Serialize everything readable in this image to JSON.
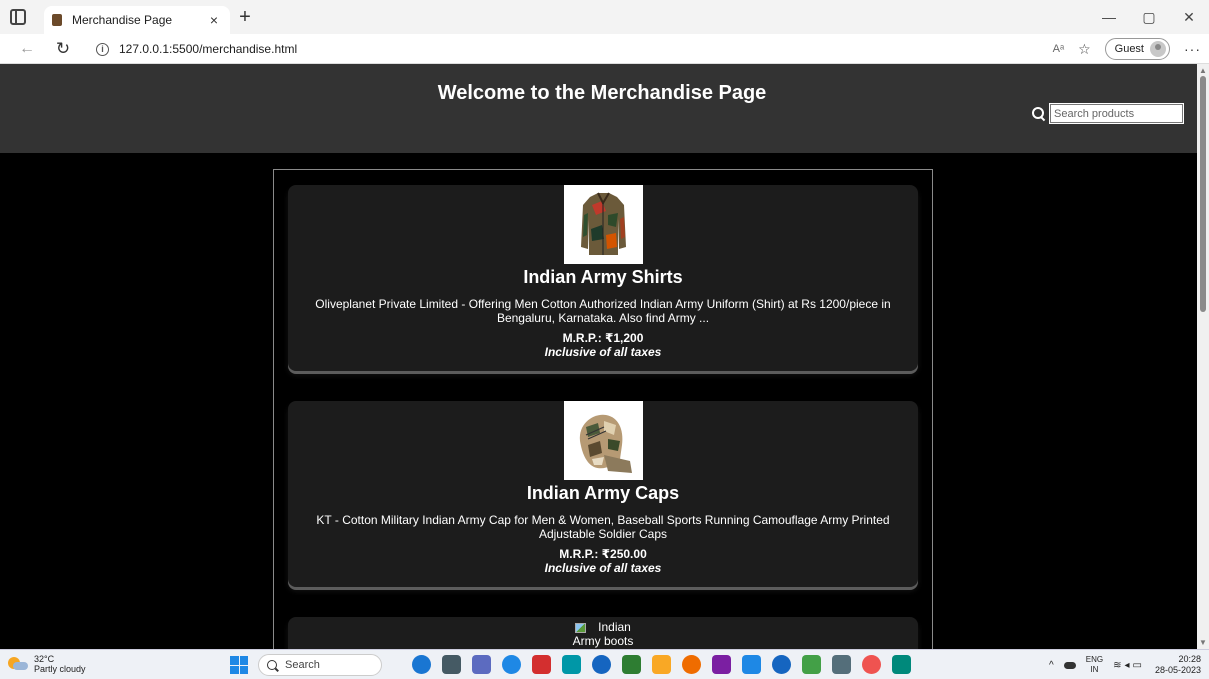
{
  "browser": {
    "tab_title": "Merchandise Page",
    "tab_close": "×",
    "new_tab": "+",
    "url": "127.0.0.1:5500/merchandise.html",
    "read_aloud": "Aᵃ",
    "profile_label": "Guest",
    "more": "···",
    "window_controls": [
      "—",
      "▢",
      "✕"
    ]
  },
  "page": {
    "title": "Welcome to the Merchandise Page",
    "search_placeholder": "Search products"
  },
  "products": [
    {
      "title": "Indian Army Shirts",
      "description": "Oliveplanet Private Limited - Offering Men Cotton Authorized Indian Army Uniform (Shirt) at Rs 1200/piece in Bengaluru, Karnataka. Also find Army ...",
      "price": "M.R.P.: ₹1,200",
      "tax_note": "Inclusive of all taxes",
      "image": "camouflage-shirt"
    },
    {
      "title": "Indian Army Caps",
      "description": "KT - Cotton Military Indian Army Cap for Men & Women, Baseball Sports Running Camouflage Army Printed Adjustable Soldier Caps",
      "price": "M.R.P.: ₹250.00",
      "tax_note": "Inclusive of all taxes",
      "image": "camouflage-cap"
    },
    {
      "image_alt_line1": "Indian",
      "image_alt_line2": "Army boots"
    }
  ],
  "taskbar": {
    "weather_temp": "32°C",
    "weather_desc": "Partly cloudy",
    "search_label": "Search",
    "lang_1": "ENG",
    "lang_2": "IN",
    "time": "20:28",
    "date": "28-05-2023",
    "app_colors": [
      "#1976d2",
      "#455a64",
      "#5c6bc0",
      "#1e88e5",
      "#d32f2f",
      "#0097a7",
      "#1565c0",
      "#2e7d32",
      "#f9a825",
      "#ef6c00",
      "#7b1fa2",
      "#1e88e5",
      "#1565c0",
      "#43a047",
      "#546e7a",
      "#ef5350",
      "#00897b"
    ]
  }
}
